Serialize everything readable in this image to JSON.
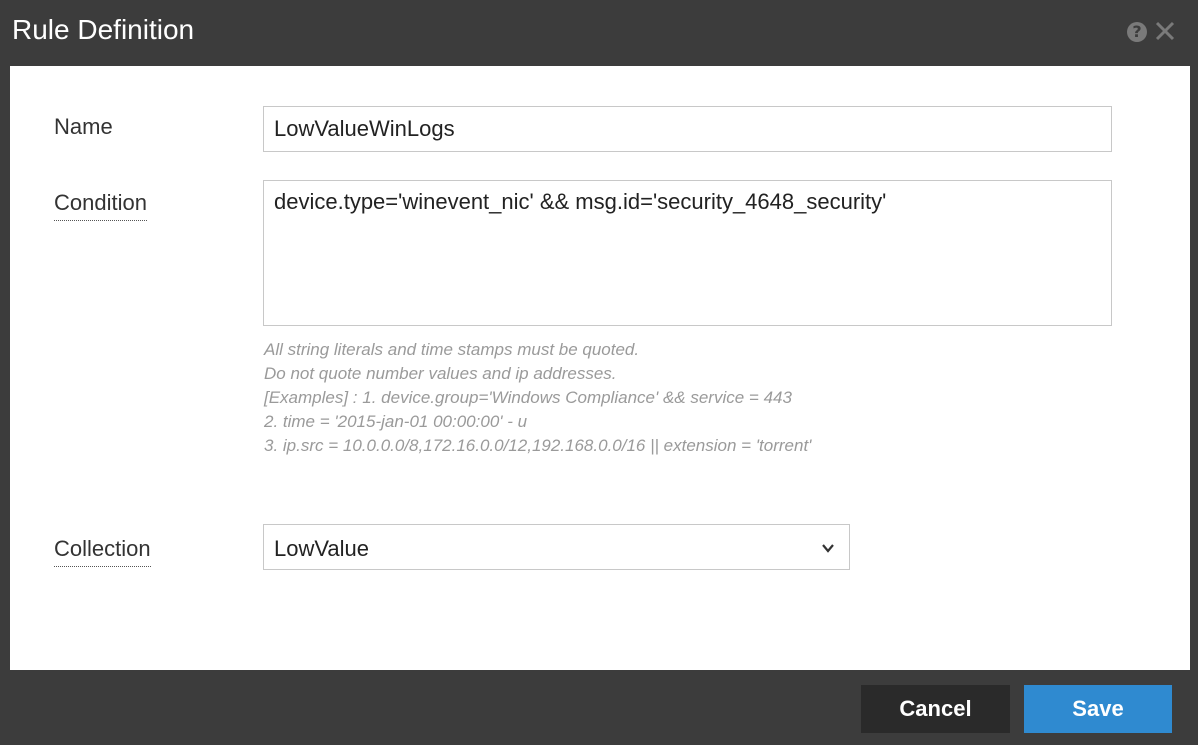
{
  "dialog": {
    "title": "Rule Definition",
    "help_icon": "help-icon",
    "close_icon": "close-icon"
  },
  "form": {
    "name_label": "Name",
    "name_value": "LowValueWinLogs",
    "condition_label": "Condition",
    "condition_value": "device.type='winevent_nic' && msg.id='security_4648_security'",
    "hint_lines": [
      "All string literals and time stamps must be quoted.",
      "Do not quote number values and ip addresses.",
      "[Examples] : 1. device.group='Windows Compliance' && service = 443",
      "2. time = '2015-jan-01 00:00:00' - u",
      "3. ip.src = 10.0.0.0/8,172.16.0.0/12,192.168.0.0/16 || extension = 'torrent'"
    ],
    "collection_label": "Collection",
    "collection_value": "LowValue"
  },
  "footer": {
    "cancel_label": "Cancel",
    "save_label": "Save"
  },
  "colors": {
    "titlebar": "#3c3c3c",
    "save_button": "#2f8ad0",
    "cancel_button": "#2a2a2a"
  }
}
